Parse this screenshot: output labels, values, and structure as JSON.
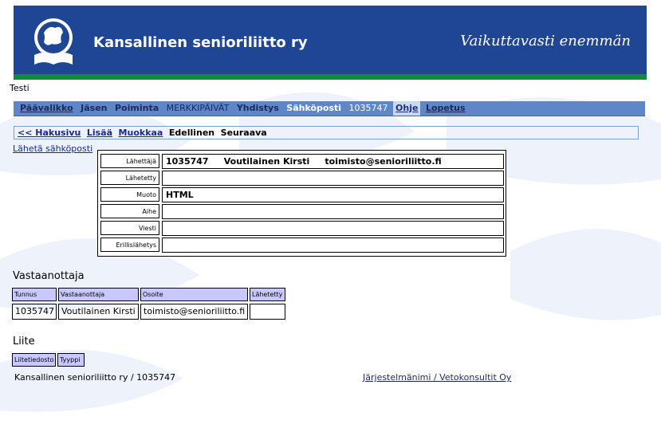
{
  "banner": {
    "org_name": "Kansallinen senioriliitto ry",
    "slogan": "Vaikuttavasti enemmän",
    "colors": {
      "banner_bg": "#1f4595",
      "green_stripe": "#128a3c"
    }
  },
  "env_label": "Testi",
  "nav": {
    "items": [
      {
        "label": "Päävalikko"
      },
      {
        "label": "Jäsen"
      },
      {
        "label": "Poiminta"
      },
      {
        "label": "MERKKIPÄIVÄT"
      },
      {
        "label": "Yhdistys"
      },
      {
        "label": "Sähköposti"
      },
      {
        "label": "1035747"
      },
      {
        "label": "Ohje"
      },
      {
        "label": "Lopetus"
      }
    ]
  },
  "subnav": {
    "back": "<< Hakusivu",
    "add": "Lisää",
    "edit": "Muokkaa",
    "prev": "Edellinen",
    "next": "Seuraava"
  },
  "send_link": "Lähetä sähköposti",
  "form": {
    "sender_label": "Lähettäjä",
    "sender_value": "1035747     Voutilainen Kirsti     toimisto@senioriliitto.fi",
    "sent_label": "Lähetetty",
    "sent_value": "",
    "format_label": "Muoto",
    "format_value": "HTML",
    "subject_label": "Aihe",
    "subject_value": "",
    "message_label": "Viesti",
    "message_value": "",
    "individual_label": "Erillislähetys",
    "individual_value": ""
  },
  "recipients": {
    "title": "Vastaanottaja",
    "headers": [
      "Tunnus",
      "Vastaanottaja",
      "Osoite",
      "Lähetetty"
    ],
    "rows": [
      [
        "1035747",
        "Voutilainen Kirsti",
        "toimisto@senioriliitto.fi",
        ""
      ]
    ]
  },
  "attachments": {
    "title": "Liite",
    "headers": [
      "Liitetiedosto",
      "Tyyppi"
    ]
  },
  "footer": {
    "left": "Kansallinen senioriliitto ry / 1035747",
    "right": "Järjestelmänimi / Vetokonsultit Oy"
  }
}
